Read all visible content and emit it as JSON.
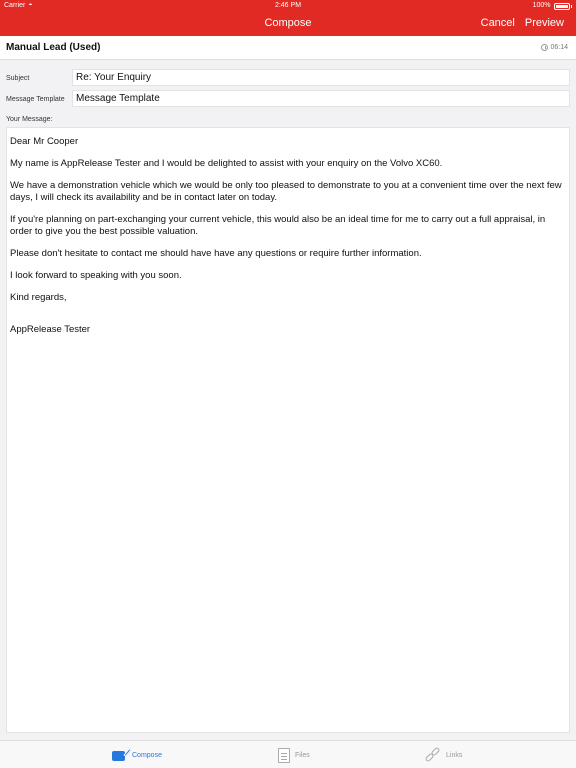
{
  "status": {
    "carrier": "Carrier",
    "time": "2:46 PM",
    "battery": "100%"
  },
  "nav": {
    "title": "Compose",
    "cancel": "Cancel",
    "preview": "Preview"
  },
  "lead": {
    "title": "Manual Lead (Used)",
    "time": "06:14"
  },
  "form": {
    "subject_label": "Subject",
    "subject_value": "Re: Your Enquiry",
    "template_label": "Message Template",
    "template_value": "Message Template",
    "message_label": "Your Message:"
  },
  "message": {
    "p1": "Dear Mr Cooper",
    "p2": "My name is AppRelease Tester and I would be delighted to assist with your enquiry on the Volvo XC60.",
    "p3": "We have a demonstration vehicle which we would be only too pleased to demonstrate to you at a convenient time over the next few days, I will check its availability and be in contact later on today.",
    "p4": "If you're planning on part-exchanging your current vehicle, this would also be an ideal time for me to carry out a full appraisal, in order to give you the best possible valuation.",
    "p5": "Please don't hesitate to contact me should have have any questions or require further information.",
    "p6": "I look forward to speaking with you soon.",
    "p7": "Kind regards,",
    "p8": "AppRelease Tester"
  },
  "tabs": {
    "compose": "Compose",
    "files": "Files",
    "links": "Links"
  },
  "colors": {
    "brand_red": "#e12a23",
    "active_blue": "#2478e0"
  }
}
